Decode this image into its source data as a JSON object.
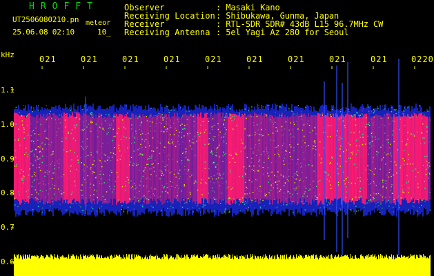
{
  "header": {
    "app_title": "HROFFT",
    "file_name": "UT2506080210.pn",
    "mode": "meteor",
    "datetime": "25.06.08 02:10",
    "interval": "10_"
  },
  "metadata": [
    {
      "key": "Observer",
      "value": ": Masaki Kano"
    },
    {
      "key": "Receiving Location",
      "value": ": Shibukawa, Gunma, Japan"
    },
    {
      "key": "Receiver",
      "value": ": RTL-SDR SDR# 43dB L15 96.7MHz CW"
    },
    {
      "key": "Receiving Antenna",
      "value": ": 5el Yagi Az 280 for Seoul"
    }
  ],
  "axis": {
    "unit": "kHz",
    "y_ticks": [
      "1.1",
      "1.0",
      "0.9",
      "0.8",
      "0.7",
      "0.6"
    ],
    "x_ticks": [
      "021",
      "021",
      "021",
      "021",
      "021",
      "021",
      "021",
      "021",
      "021",
      "0220"
    ]
  },
  "colors": {
    "background": "#000000",
    "text": "#ffff00",
    "title": "#00e000",
    "echo_core": "#ff1a6e",
    "noise_low": "#1a28d8",
    "signal_mid": "#22d6c0",
    "power_bar": "#ffff00"
  }
}
